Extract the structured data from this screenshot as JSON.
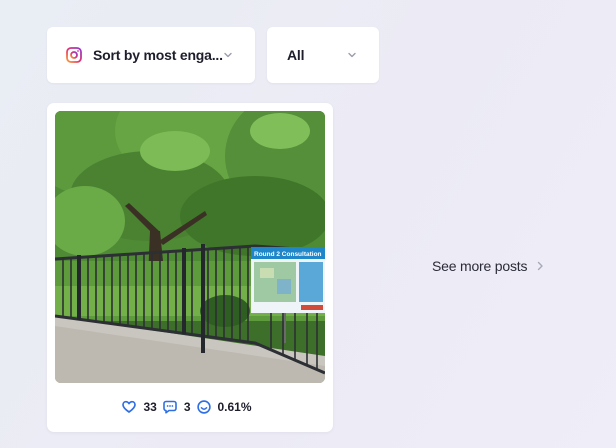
{
  "sort_dropdown": {
    "label": "Sort by most enga...",
    "icon": "instagram-icon"
  },
  "filter_dropdown": {
    "label": "All",
    "icon": "chevron-down-icon"
  },
  "post_card": {
    "image_alt": "Trees behind a metal fence with a Round 2 Consultation sign",
    "sign_title": "Round 2 Consultation",
    "likes": "33",
    "comments": "3",
    "engagement": "0.61%"
  },
  "see_more": {
    "label": "See more posts"
  },
  "colors": {
    "accent": "#2f6fe4",
    "text": "#1d1d2b",
    "background": "#eceef6"
  }
}
